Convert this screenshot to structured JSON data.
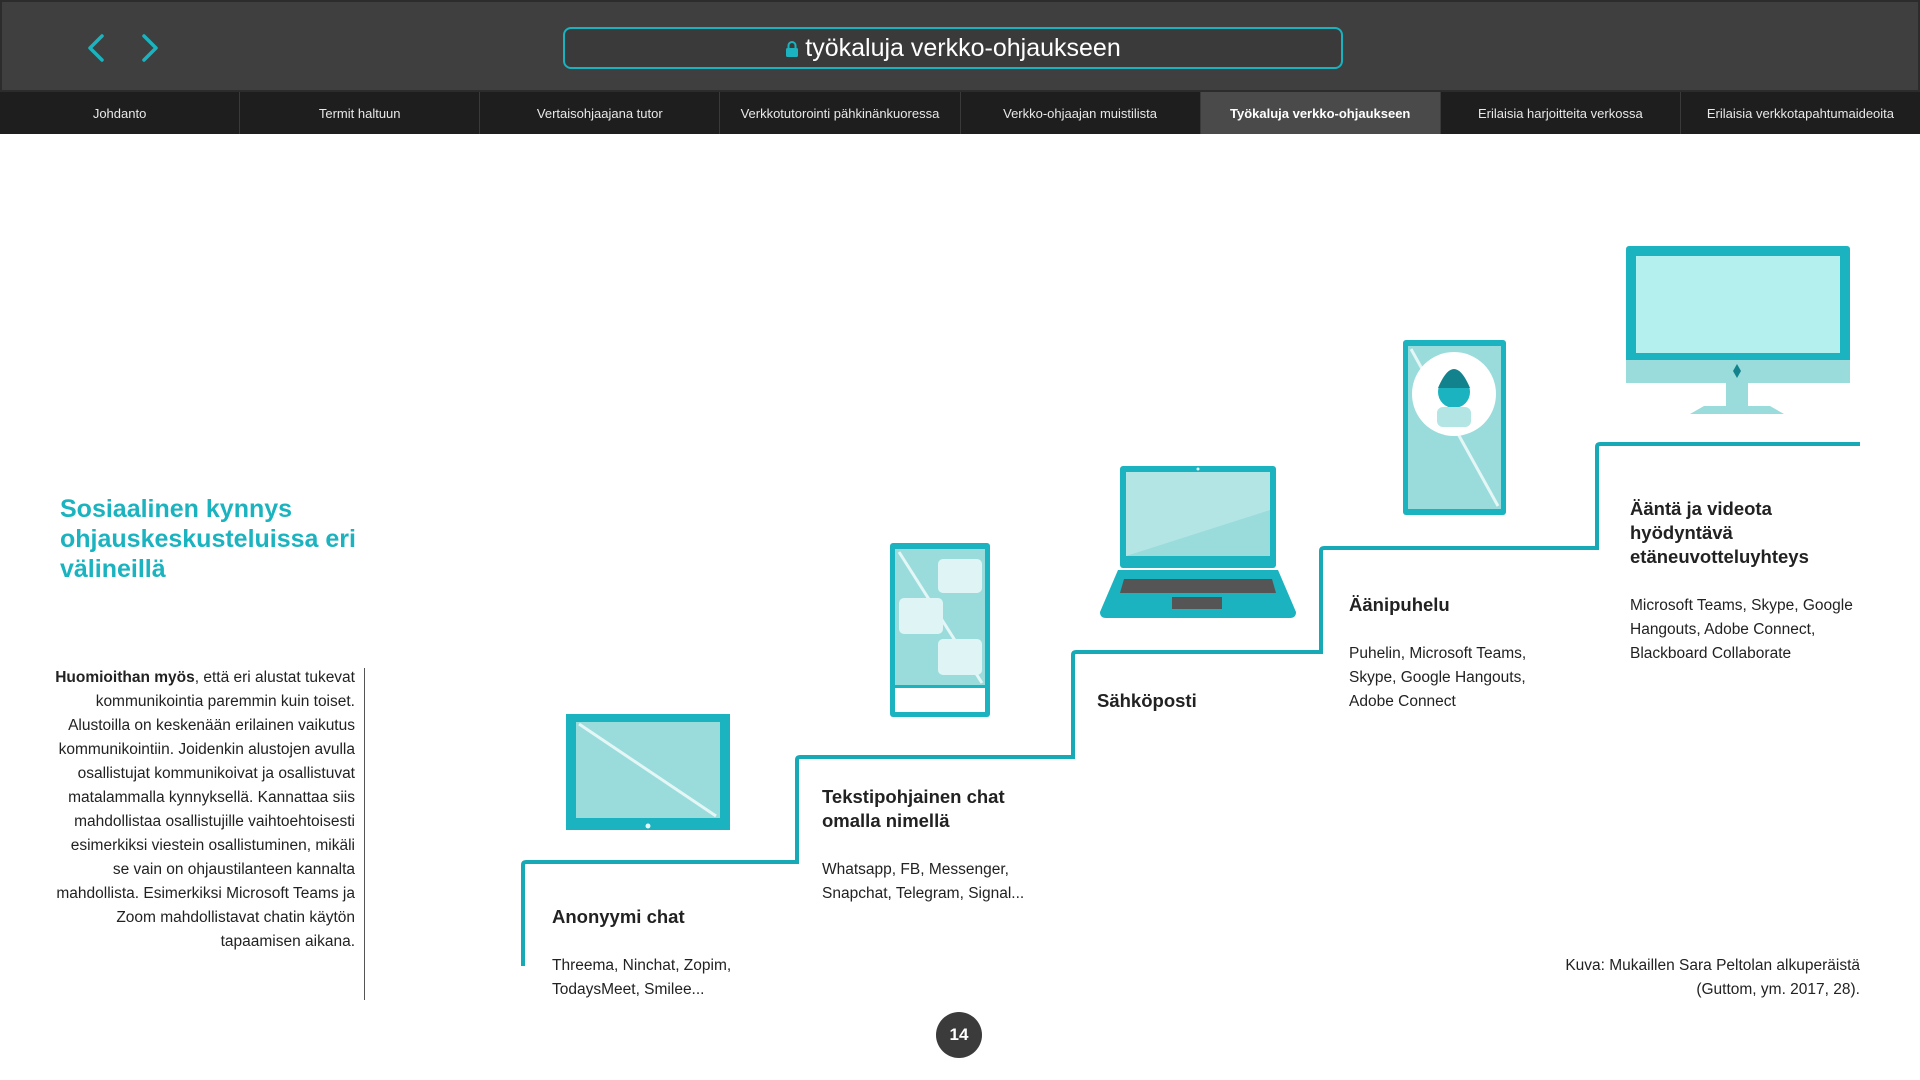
{
  "browser": {
    "url_title": "työkaluja verkko-ohjaukseen",
    "back_icon": "chevron-left-icon",
    "forward_icon": "chevron-right-icon",
    "lock_icon": "lock-icon",
    "accent_color": "#1ab3bf"
  },
  "tabs": [
    {
      "label": "Johdanto"
    },
    {
      "label": "Termit haltuun"
    },
    {
      "label": "Vertaisohjaajana tutor"
    },
    {
      "label": "Verkkotutorointi pähkinänkuoressa"
    },
    {
      "label": "Verkko-ohjaajan muistilista"
    },
    {
      "label": "Työkaluja verkko-ohjaukseen",
      "active": true
    },
    {
      "label": "Erilaisia harjoitteita verkossa"
    },
    {
      "label": "Erilaisia verkkotapahtumaideoita"
    }
  ],
  "main": {
    "heading": "Sosiaalinen kynnys ohjauskeskusteluissa eri välineillä",
    "note_bold": "Huomioithan myös",
    "note_text": ", että eri alustat tukevat kommunikointia paremmin kuin toiset. Alustoilla on keskenään erilainen vaikutus kommunikointiin. Joidenkin alustojen avulla osallistujat kommunikoivat ja osallistuvat matalammalla kynnyksellä. Kannattaa siis mahdollistaa osallistujille vaihtoehtoisesti esimerkiksi viestein osallistuminen, mikäli se vain on ohjaustilanteen kannalta mahdollista. Esimerkiksi Microsoft Teams ja Zoom mahdollistavat chatin käytön tapaamisen aikana."
  },
  "steps": [
    {
      "title": "Anonyymi chat",
      "desc": "Threema, Ninchat, Zopim, TodaysMeet, Smilee...",
      "icon": "tablet-icon"
    },
    {
      "title": "Tekstipohjainen chat omalla nimellä",
      "desc": "Whatsapp, FB, Messenger, Snapchat, Telegram, Signal...",
      "icon": "phone-chat-icon"
    },
    {
      "title": "Sähköposti",
      "desc": "",
      "icon": "laptop-icon"
    },
    {
      "title": "Äänipuhelu",
      "desc": "Puhelin, Microsoft Teams, Skype, Google Hangouts, Adobe Connect",
      "icon": "phone-call-icon"
    },
    {
      "title": "Ääntä ja videota hyödyntävä etäneuvotteluyhteys",
      "desc": "Microsoft Teams, Skype, Google Hangouts, Adobe Connect, Blackboard Collaborate",
      "icon": "desktop-monitor-icon"
    }
  ],
  "credit": "Kuva: Mukaillen Sara Peltolan alkuperäistä (Guttom, ym. 2017, 28).",
  "page_number": "14"
}
